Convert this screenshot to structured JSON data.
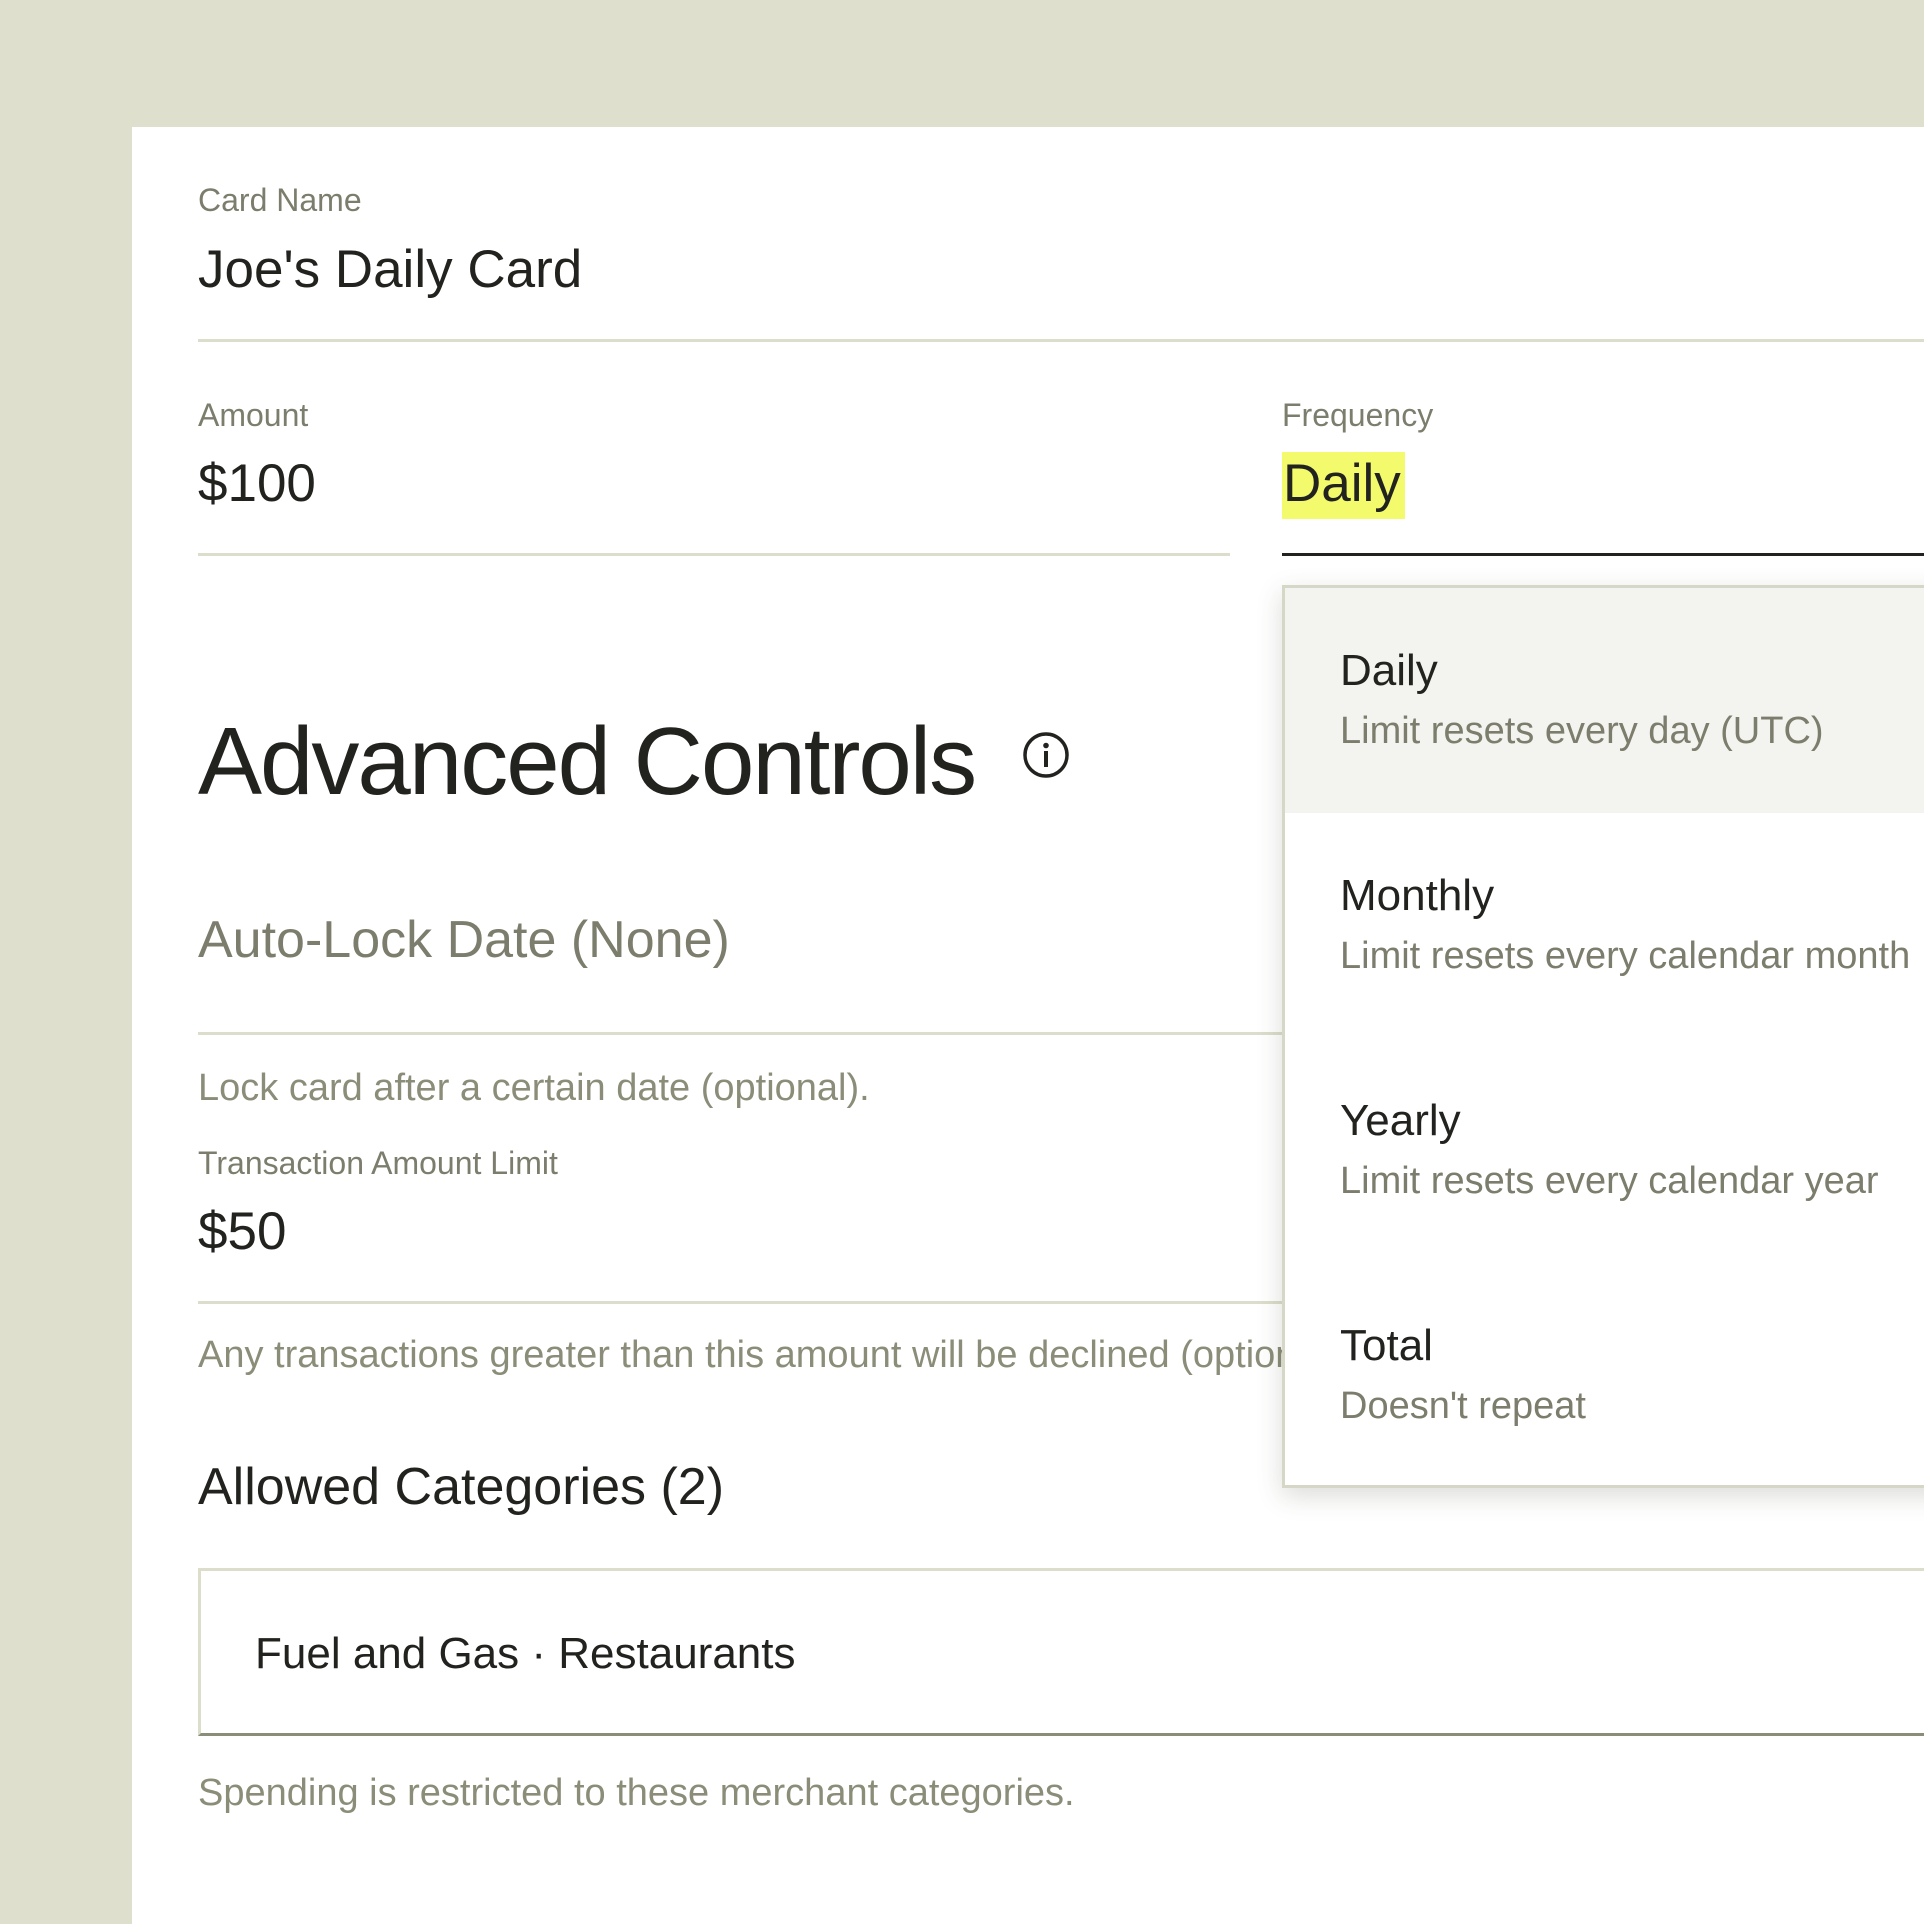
{
  "form": {
    "card_name": {
      "label": "Card Name",
      "value": "Joe's Daily Card"
    },
    "amount": {
      "label": "Amount",
      "value": "$100"
    },
    "frequency": {
      "label": "Frequency",
      "value": "Daily"
    }
  },
  "advanced": {
    "title": "Advanced Controls",
    "info_icon": "info-circle-icon",
    "auto_lock": {
      "label": "Auto-Lock Date (None)",
      "helper": "Lock card after a certain date (optional)."
    },
    "transaction_limit": {
      "label": "Transaction Amount Limit",
      "value": "$50",
      "helper": "Any transactions greater than this amount will be declined (optional)."
    },
    "categories": {
      "title": "Allowed Categories (2)",
      "value": "Fuel and Gas · Restaurants",
      "helper": "Spending is restricted to these merchant categories."
    }
  },
  "frequency_dropdown": {
    "selected": "Daily",
    "options": [
      {
        "title": "Daily",
        "description": "Limit resets every day (UTC)"
      },
      {
        "title": "Monthly",
        "description": "Limit resets every calendar month"
      },
      {
        "title": "Yearly",
        "description": "Limit resets every calendar year"
      },
      {
        "title": "Total",
        "description": "Doesn't repeat"
      }
    ]
  },
  "colors": {
    "background": "#dfdfcd",
    "panel": "#ffffff",
    "text": "#22231f",
    "muted": "#7c7d6c",
    "highlight": "#f3fa6b",
    "selected_option": "#f3f3ef"
  }
}
